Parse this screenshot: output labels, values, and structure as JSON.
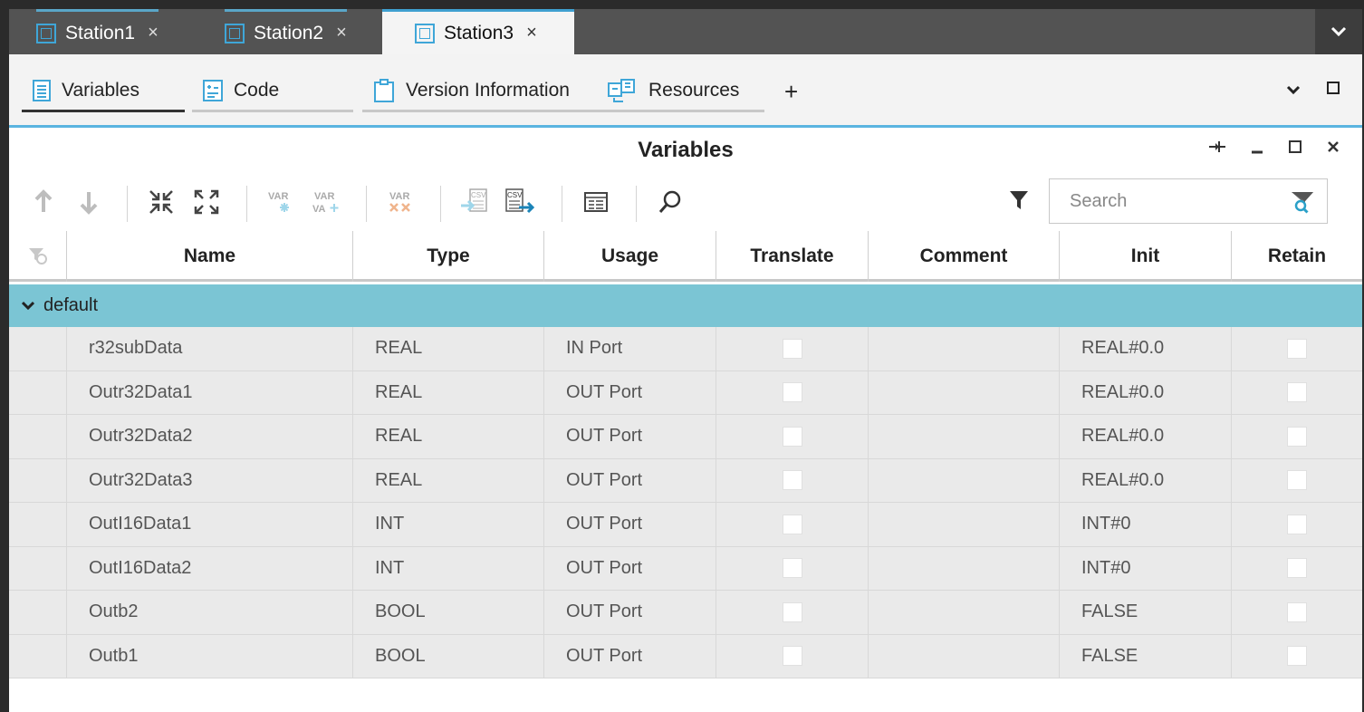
{
  "station_tabs": [
    {
      "label": "Station1",
      "close": "×",
      "active": false
    },
    {
      "label": "Station2",
      "close": "×",
      "active": false
    },
    {
      "label": "Station3",
      "close": "×",
      "active": true
    }
  ],
  "section_tabs": [
    {
      "label": "Variables",
      "icon": "list-document-icon",
      "active": true
    },
    {
      "label": "Code",
      "icon": "code-document-icon",
      "active": false
    },
    {
      "label": "Version Information",
      "icon": "clipboard-icon",
      "active": false
    },
    {
      "label": "Resources",
      "icon": "resources-icon",
      "active": false
    }
  ],
  "section_add": "+",
  "panel": {
    "title": "Variables",
    "search_placeholder": "Search"
  },
  "toolbar_icons": [
    "move-up-icon",
    "move-down-icon",
    "collapse-all-icon",
    "expand-all-icon",
    "add-var-icon",
    "add-var-multiple-icon",
    "delete-var-icon",
    "import-csv-icon",
    "export-csv-icon",
    "table-view-icon",
    "find-icon"
  ],
  "columns": [
    "Name",
    "Type",
    "Usage",
    "Translate",
    "Comment",
    "Init",
    "Retain"
  ],
  "group": {
    "label": "default",
    "expanded": true
  },
  "rows": [
    {
      "name": "r32subData",
      "type": "REAL",
      "usage": "IN Port",
      "translate": false,
      "comment": "",
      "init": "REAL#0.0",
      "retain": false
    },
    {
      "name": "Outr32Data1",
      "type": "REAL",
      "usage": "OUT Port",
      "translate": false,
      "comment": "",
      "init": "REAL#0.0",
      "retain": false
    },
    {
      "name": "Outr32Data2",
      "type": "REAL",
      "usage": "OUT Port",
      "translate": false,
      "comment": "",
      "init": "REAL#0.0",
      "retain": false
    },
    {
      "name": "Outr32Data3",
      "type": "REAL",
      "usage": "OUT Port",
      "translate": false,
      "comment": "",
      "init": "REAL#0.0",
      "retain": false
    },
    {
      "name": "OutI16Data1",
      "type": "INT",
      "usage": "OUT Port",
      "translate": false,
      "comment": "",
      "init": "INT#0",
      "retain": false
    },
    {
      "name": "OutI16Data2",
      "type": "INT",
      "usage": "OUT Port",
      "translate": false,
      "comment": "",
      "init": "INT#0",
      "retain": false
    },
    {
      "name": "Outb2",
      "type": "BOOL",
      "usage": "OUT Port",
      "translate": false,
      "comment": "",
      "init": "FALSE",
      "retain": false
    },
    {
      "name": "Outb1",
      "type": "BOOL",
      "usage": "OUT Port",
      "translate": false,
      "comment": "",
      "init": "FALSE",
      "retain": false
    }
  ],
  "colors": {
    "accent": "#3fa6d8",
    "group_row": "#7bc5d4",
    "station_bar": "#535353"
  }
}
